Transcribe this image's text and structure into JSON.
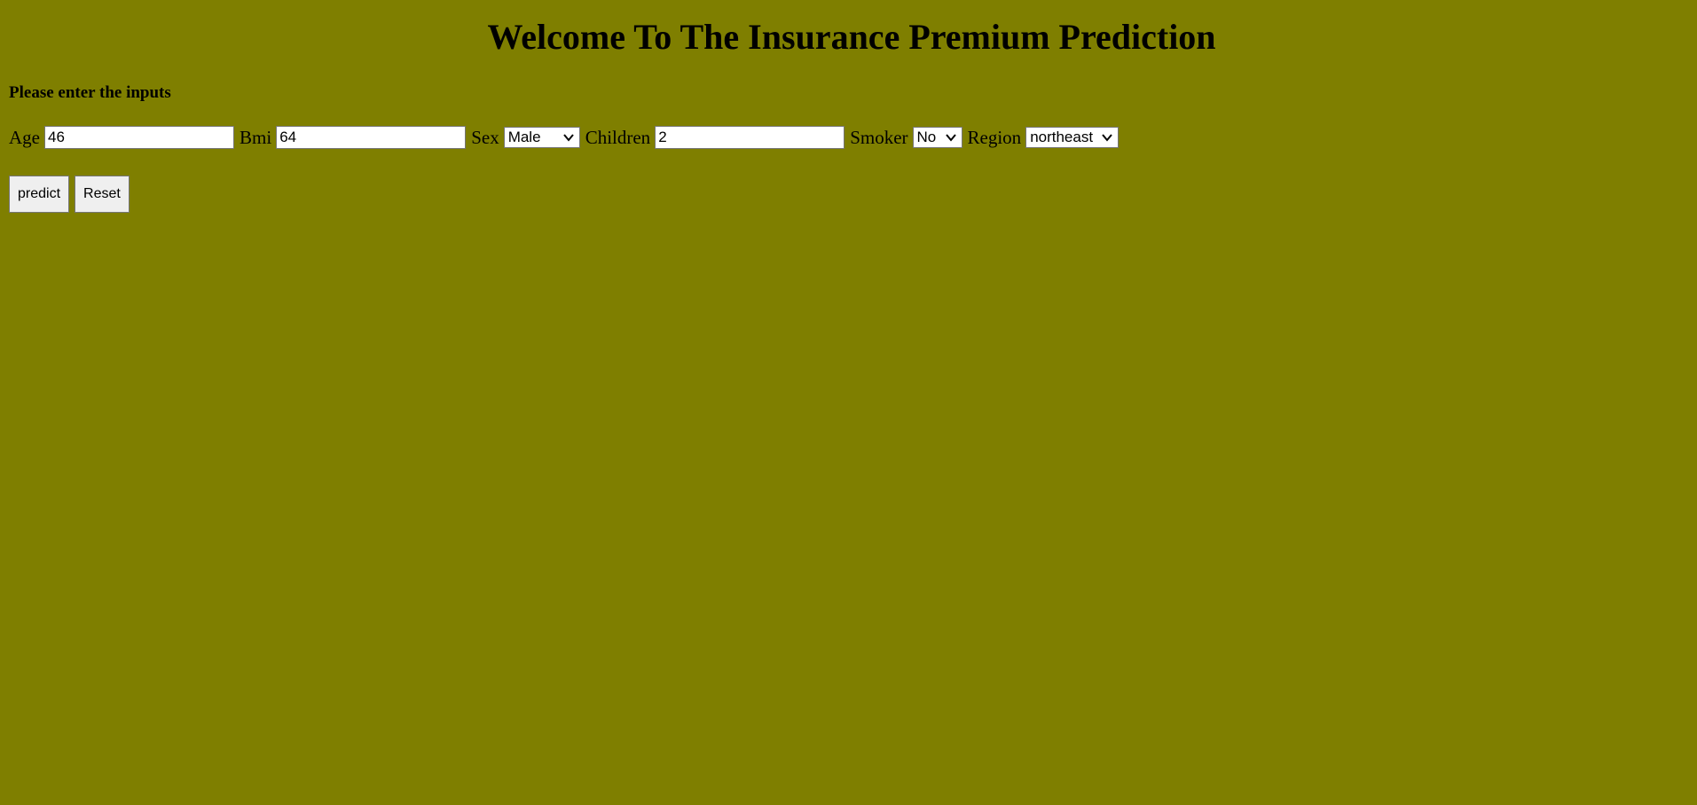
{
  "header": {
    "title": "Welcome To The Insurance Premium Prediction",
    "subtitle": "Please enter the inputs"
  },
  "form": {
    "age": {
      "label": "Age",
      "value": "46"
    },
    "bmi": {
      "label": "Bmi",
      "value": "64"
    },
    "sex": {
      "label": "Sex",
      "selected": "Male"
    },
    "children": {
      "label": "Children",
      "value": "2"
    },
    "smoker": {
      "label": "Smoker",
      "selected": "No"
    },
    "region": {
      "label": "Region",
      "selected": "northeast"
    }
  },
  "buttons": {
    "predict_label": "predict",
    "reset_label": "Reset"
  },
  "colors": {
    "background": "#7f7f00"
  }
}
